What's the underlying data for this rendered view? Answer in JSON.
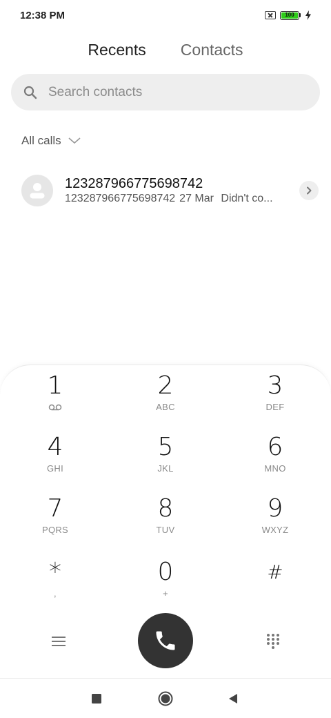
{
  "status_bar": {
    "time": "12:38 PM",
    "battery_level": "100",
    "icons": [
      "sim-off-icon",
      "battery-icon",
      "charging-bolt-icon"
    ]
  },
  "tabs": [
    {
      "label": "Recents",
      "active": true
    },
    {
      "label": "Contacts",
      "active": false
    }
  ],
  "search": {
    "placeholder": "Search contacts",
    "icon": "search-icon"
  },
  "filter": {
    "label": "All calls",
    "icon": "chevron-down-icon"
  },
  "recents": [
    {
      "name": "123287966775698742",
      "number": "123287966775698742",
      "date": "27 Mar",
      "status": "Didn't co..."
    }
  ],
  "dialpad": {
    "keys": [
      {
        "digit": "1",
        "letters": ""
      },
      {
        "digit": "2",
        "letters": "ABC"
      },
      {
        "digit": "3",
        "letters": "DEF"
      },
      {
        "digit": "4",
        "letters": "GHI"
      },
      {
        "digit": "5",
        "letters": "JKL"
      },
      {
        "digit": "6",
        "letters": "MNO"
      },
      {
        "digit": "7",
        "letters": "PQRS"
      },
      {
        "digit": "8",
        "letters": "TUV"
      },
      {
        "digit": "9",
        "letters": "WXYZ"
      },
      {
        "digit": "*",
        "letters": ","
      },
      {
        "digit": "0",
        "letters": "+"
      },
      {
        "digit": "#",
        "letters": ""
      }
    ],
    "voicemail_icon": "voicemail-icon"
  },
  "actions": {
    "menu_icon": "menu-icon",
    "call_icon": "phone-icon",
    "keypad_icon": "dialpad-icon"
  },
  "nav_bar": {
    "buttons": [
      "recents-square-icon",
      "home-circle-icon",
      "back-triangle-icon"
    ]
  },
  "colors": {
    "call_button": "#333333",
    "battery_fill": "#2ecc1a",
    "search_bg": "#eeeeee",
    "avatar_bg": "#e6e6e6"
  }
}
